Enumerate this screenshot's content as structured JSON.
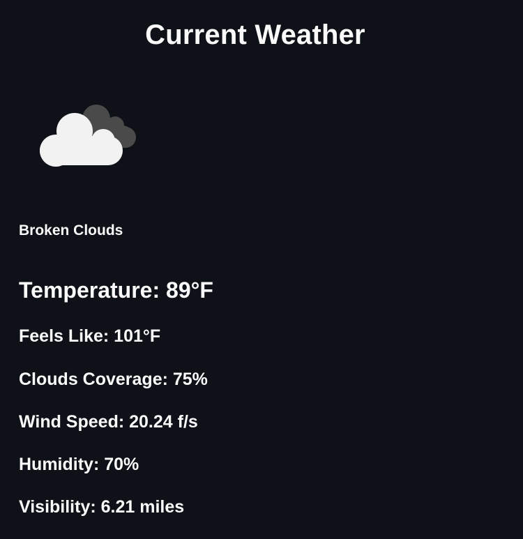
{
  "header": {
    "title": "Current Weather"
  },
  "weather": {
    "icon": "broken-clouds-icon",
    "description": "Broken Clouds",
    "temperature": "Temperature: 89°F",
    "feels_like": "Feels Like: 101°F",
    "clouds_coverage": "Clouds Coverage: 75%",
    "wind_speed": "Wind Speed: 20.24 f/s",
    "humidity": "Humidity: 70%",
    "visibility": "Visibility: 6.21 miles"
  },
  "colors": {
    "background": "#0e1117",
    "text": "#fafafa",
    "cloud_front": "#f2f2f2",
    "cloud_back": "#4a4a4a"
  }
}
